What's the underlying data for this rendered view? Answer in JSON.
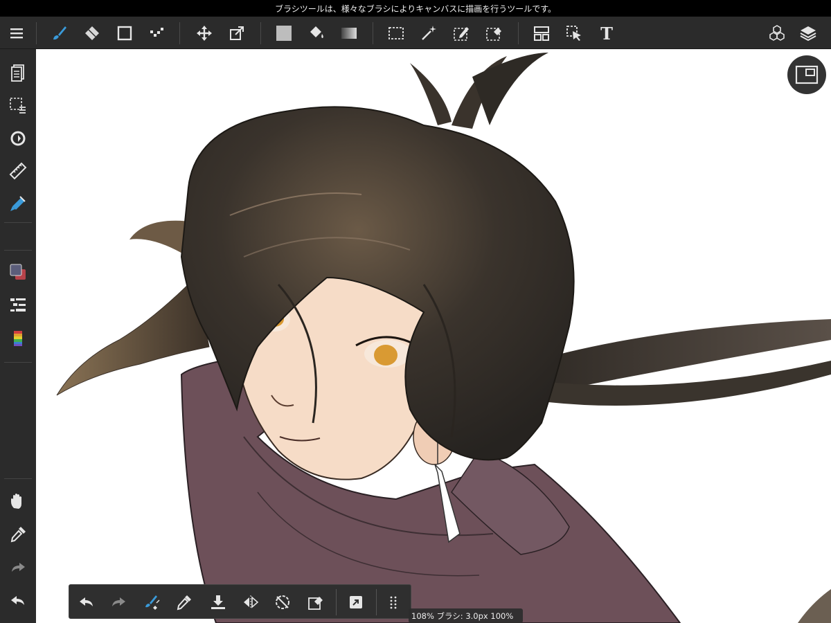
{
  "status_bar": {
    "hint": "ブラシツールは、様々なブラシによりキャンバスに描画を行うツールです。"
  },
  "toolbar": {
    "icons": [
      "menu-icon",
      "brush-icon",
      "eraser-icon",
      "rectangle-icon",
      "dot-select-icon",
      "move-icon",
      "transform-icon",
      "fill-color-icon",
      "bucket-icon",
      "gradient-icon",
      "select-rect-icon",
      "magic-wand-icon",
      "select-pen-icon",
      "select-eraser-icon",
      "panel-icon",
      "select-arrow-icon",
      "text-icon",
      "material-icon",
      "layers-icon"
    ],
    "text_tool_glyph": "T"
  },
  "left_bar": {
    "icons": [
      "pages-icon",
      "selection-list-icon",
      "rotate-icon",
      "ruler-icon",
      "pen-icon",
      "color-swatches-icon",
      "brush-list-icon",
      "color-bar-icon",
      "hand-icon",
      "eyedropper-icon",
      "redo-icon",
      "undo-icon"
    ]
  },
  "colors": {
    "accent": "#3a9ad9",
    "foreground_swatch": "#5b5d7a",
    "background_swatch": "#b5424a",
    "canvas": "#ffffff",
    "robe": "#6d5059",
    "hair": "#2e2a25"
  },
  "quick_bar": {
    "icons": [
      "undo-icon",
      "redo-icon",
      "brush-toggle-icon",
      "eyedropper-icon",
      "import-icon",
      "flip-icon",
      "rotate-reset-icon",
      "clear-icon",
      "share-icon",
      "grid-icon"
    ]
  },
  "status_pill": {
    "text": "108% ブラシ: 3.0px 100%"
  }
}
